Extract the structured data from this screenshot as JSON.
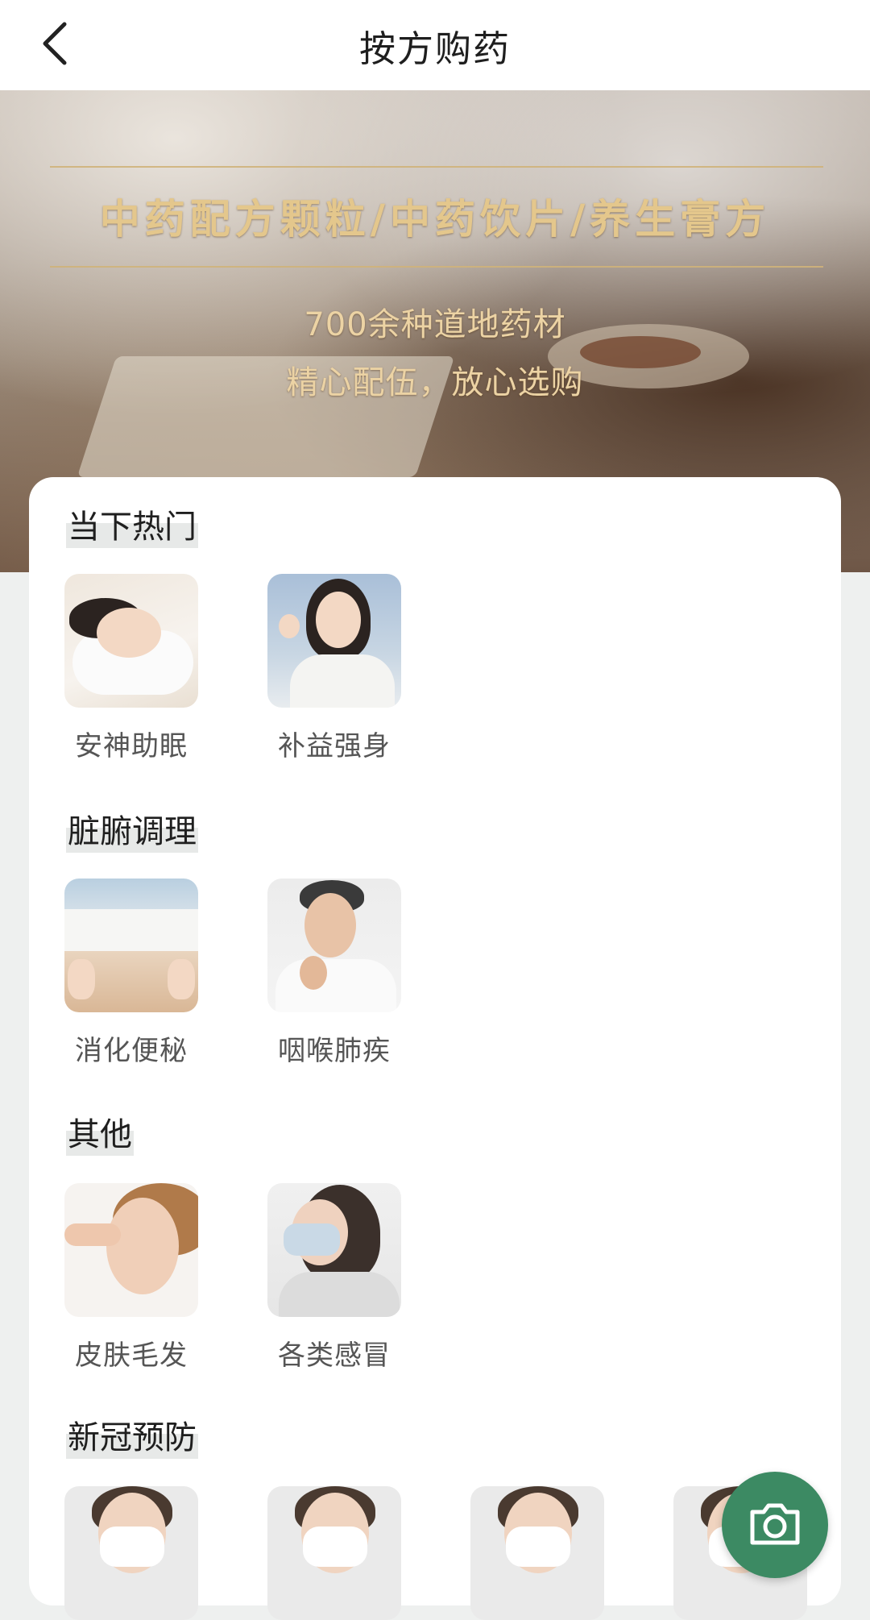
{
  "header": {
    "title": "按方购药",
    "back_icon": "chevron-left-icon"
  },
  "banner": {
    "headline": "中药配方颗粒/中药饮片/养生膏方",
    "line1": "700余种道地药材",
    "line2": "精心配伍，放心选购",
    "accent": "#e4c78c"
  },
  "sections": [
    {
      "title": "当下热门",
      "items": [
        {
          "label": "安神助眠"
        },
        {
          "label": "补益强身"
        }
      ]
    },
    {
      "title": "脏腑调理",
      "items": [
        {
          "label": "消化便秘"
        },
        {
          "label": "咽喉肺疾"
        }
      ]
    },
    {
      "title": "其他",
      "items": [
        {
          "label": "皮肤毛发"
        },
        {
          "label": "各类感冒"
        }
      ]
    },
    {
      "title": "新冠预防",
      "items": [
        {
          "label": ""
        },
        {
          "label": ""
        },
        {
          "label": ""
        },
        {
          "label": ""
        }
      ]
    }
  ],
  "fab": {
    "icon": "camera-icon",
    "color": "#3c8a63"
  }
}
